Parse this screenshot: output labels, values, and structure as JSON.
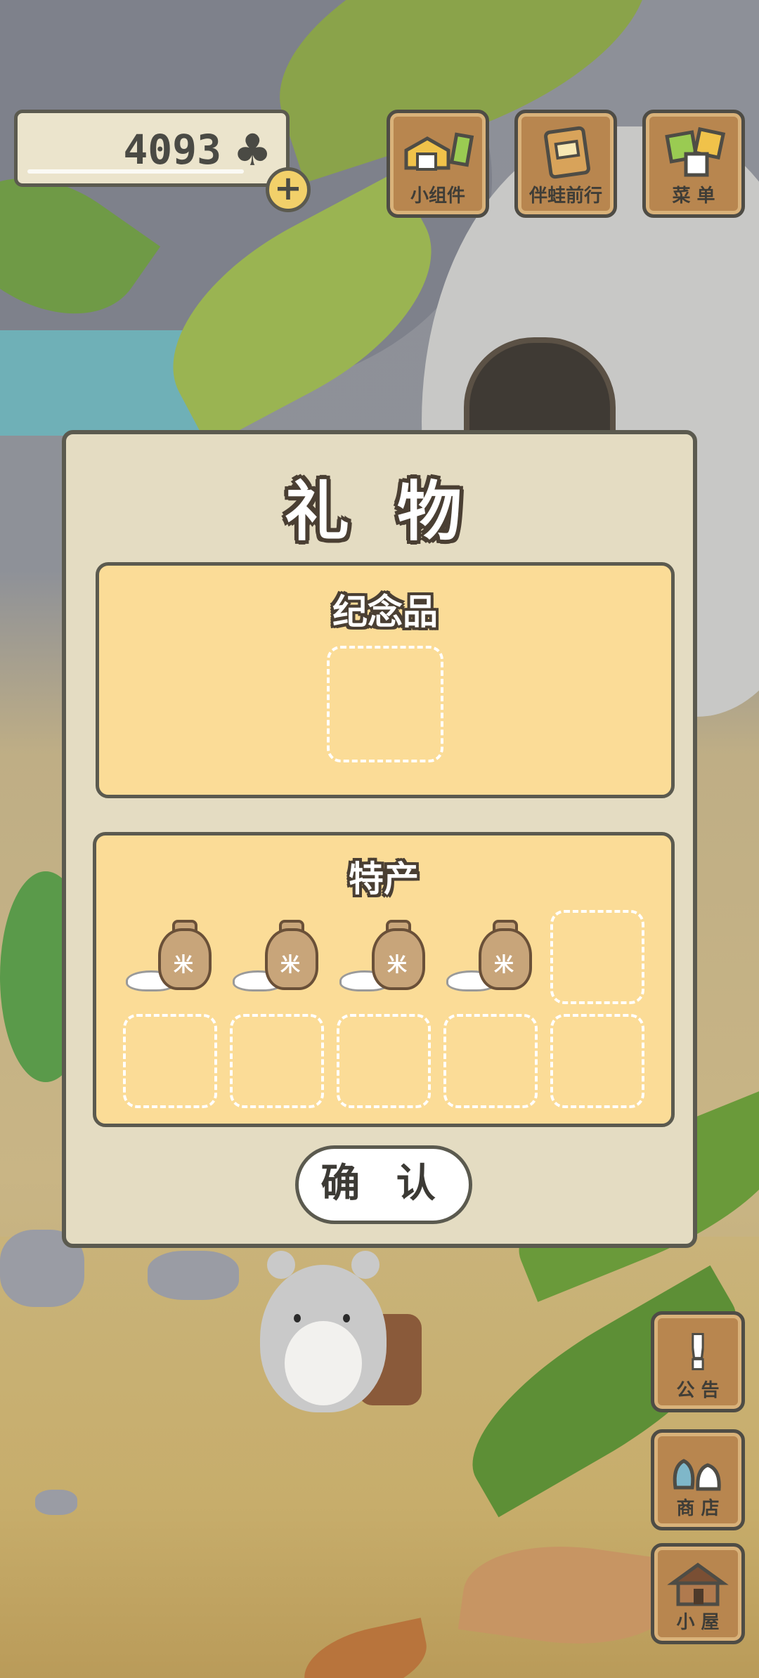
{
  "hud": {
    "currency": {
      "value": "4093",
      "icon": "clover-icon",
      "add_icon": "+"
    },
    "top_buttons": [
      {
        "label": "小组件",
        "icon": "widget-icon"
      },
      {
        "label": "伴蛙前行",
        "icon": "journey-book-icon"
      },
      {
        "label": "菜 单",
        "icon": "menu-icon"
      }
    ],
    "side_buttons": [
      {
        "label": "公 告",
        "icon": "exclamation-icon",
        "glyph": "!"
      },
      {
        "label": "商 店",
        "icon": "shop-bag-icon"
      },
      {
        "label": "小 屋",
        "icon": "house-icon"
      }
    ]
  },
  "dialog": {
    "title": "礼 物",
    "souvenir": {
      "title": "纪念品",
      "slots_filled": 0,
      "slots_total": 1
    },
    "specialty": {
      "title": "特产",
      "item_mark": "米",
      "items_filled": 4,
      "slots_total": 10
    },
    "confirm_label": "确 认"
  },
  "colors": {
    "dialog_bg": "#e4dcc2",
    "panel_bg": "#fbdc97",
    "border": "#5b5a4f",
    "button_wood": "#b8864f"
  }
}
